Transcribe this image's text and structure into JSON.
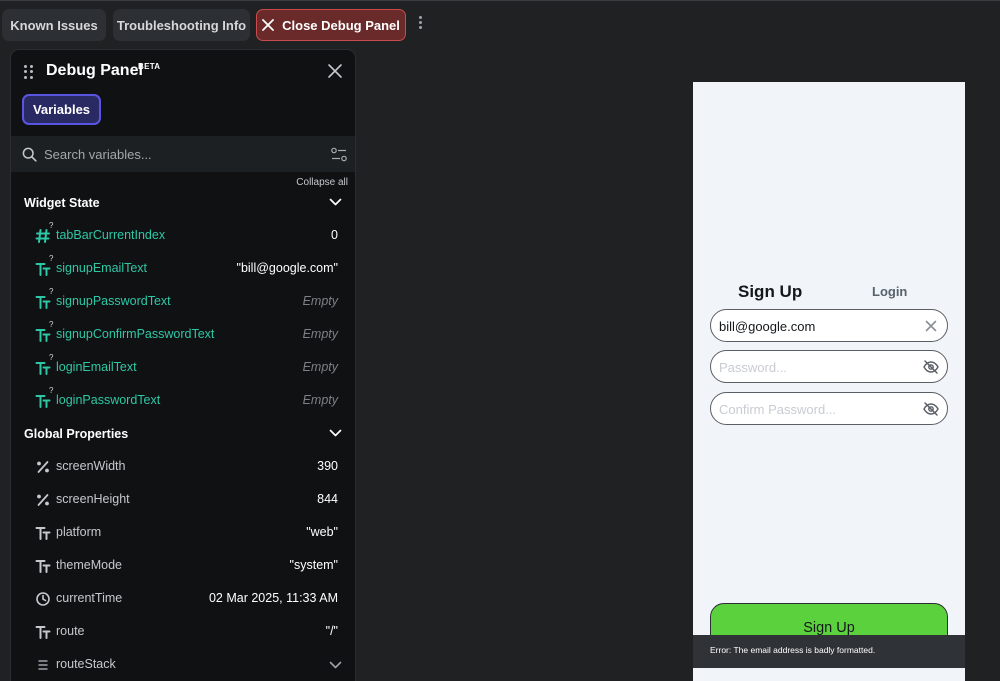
{
  "toolbar": {
    "known_issues": "Known Issues",
    "troubleshooting": "Troubleshooting Info",
    "close_debug": "Close Debug Panel"
  },
  "panel": {
    "title": "Debug Panel",
    "badge": "BETA",
    "tab_variables": "Variables",
    "search_placeholder": "Search variables...",
    "collapse_all": "Collapse all",
    "widget_state": {
      "label": "Widget State",
      "items": [
        {
          "icon": "number-icon",
          "name": "tabBarCurrentIndex",
          "value": "0",
          "empty": false
        },
        {
          "icon": "text-type-icon",
          "name": "signupEmailText",
          "value": "\"bill@google.com\"",
          "empty": false
        },
        {
          "icon": "text-type-icon",
          "name": "signupPasswordText",
          "value": "Empty",
          "empty": true
        },
        {
          "icon": "text-type-icon",
          "name": "signupConfirmPasswordText",
          "value": "Empty",
          "empty": true
        },
        {
          "icon": "text-type-icon",
          "name": "loginEmailText",
          "value": "Empty",
          "empty": true
        },
        {
          "icon": "text-type-icon",
          "name": "loginPasswordText",
          "value": "Empty",
          "empty": true
        }
      ],
      "nullable_mark": "?"
    },
    "global_properties": {
      "label": "Global Properties",
      "items": [
        {
          "icon": "percent-icon",
          "name": "screenWidth",
          "value": "390"
        },
        {
          "icon": "percent-icon",
          "name": "screenHeight",
          "value": "844"
        },
        {
          "icon": "text-type-icon",
          "name": "platform",
          "value": "\"web\""
        },
        {
          "icon": "text-type-icon",
          "name": "themeMode",
          "value": "\"system\""
        },
        {
          "icon": "clock-icon",
          "name": "currentTime",
          "value": "02 Mar 2025, 11:33 AM"
        },
        {
          "icon": "text-type-icon",
          "name": "route",
          "value": "\"/\""
        },
        {
          "icon": "list-icon",
          "name": "routeStack",
          "value": ""
        }
      ]
    }
  },
  "phone": {
    "tab_signup": "Sign Up",
    "tab_login": "Login",
    "email_value": "bill@google.com",
    "password_placeholder": "Password...",
    "confirm_placeholder": "Confirm Password...",
    "signup_button": "Sign Up",
    "error_message": "Error: The email address is badly formatted."
  },
  "colors": {
    "background": "#1f2123",
    "panel": "#101113",
    "accent_tab": "#5a55e0",
    "close_button": "#c94b4b",
    "teal_variable": "#2ec8a6",
    "signup_green": "#5bd13d"
  }
}
